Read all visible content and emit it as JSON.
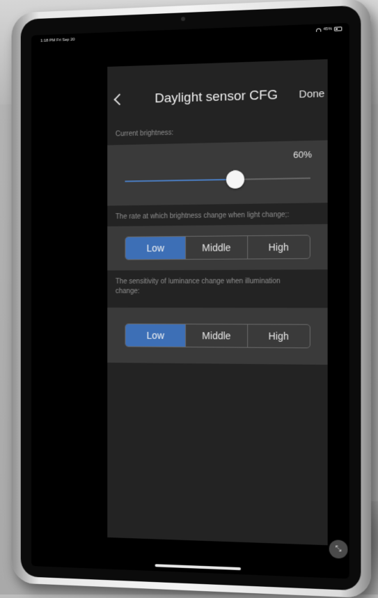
{
  "status_bar": {
    "time": "1:18 PM  Fri Sep 20",
    "battery": "45%",
    "battery_level": 0.45
  },
  "nav": {
    "title": "Daylight sensor CFG",
    "done_label": "Done",
    "back_icon": "chevron-left-icon"
  },
  "brightness": {
    "label": "Current brightness:",
    "value_text": "60%",
    "level": 0.6
  },
  "rate": {
    "label": "The rate at which brightness change when light change;:",
    "options": [
      "Low",
      "Middle",
      "High"
    ],
    "selected": "Low"
  },
  "sensitivity": {
    "label": "The sensitivity of luminance change when illumination change:",
    "options": [
      "Low",
      "Middle",
      "High"
    ],
    "selected": "Low"
  },
  "float_button_icon": "collapse-arrows-icon",
  "colors": {
    "accent": "#3d6fb6",
    "panel": "#232323",
    "section": "#3a3a3a"
  }
}
